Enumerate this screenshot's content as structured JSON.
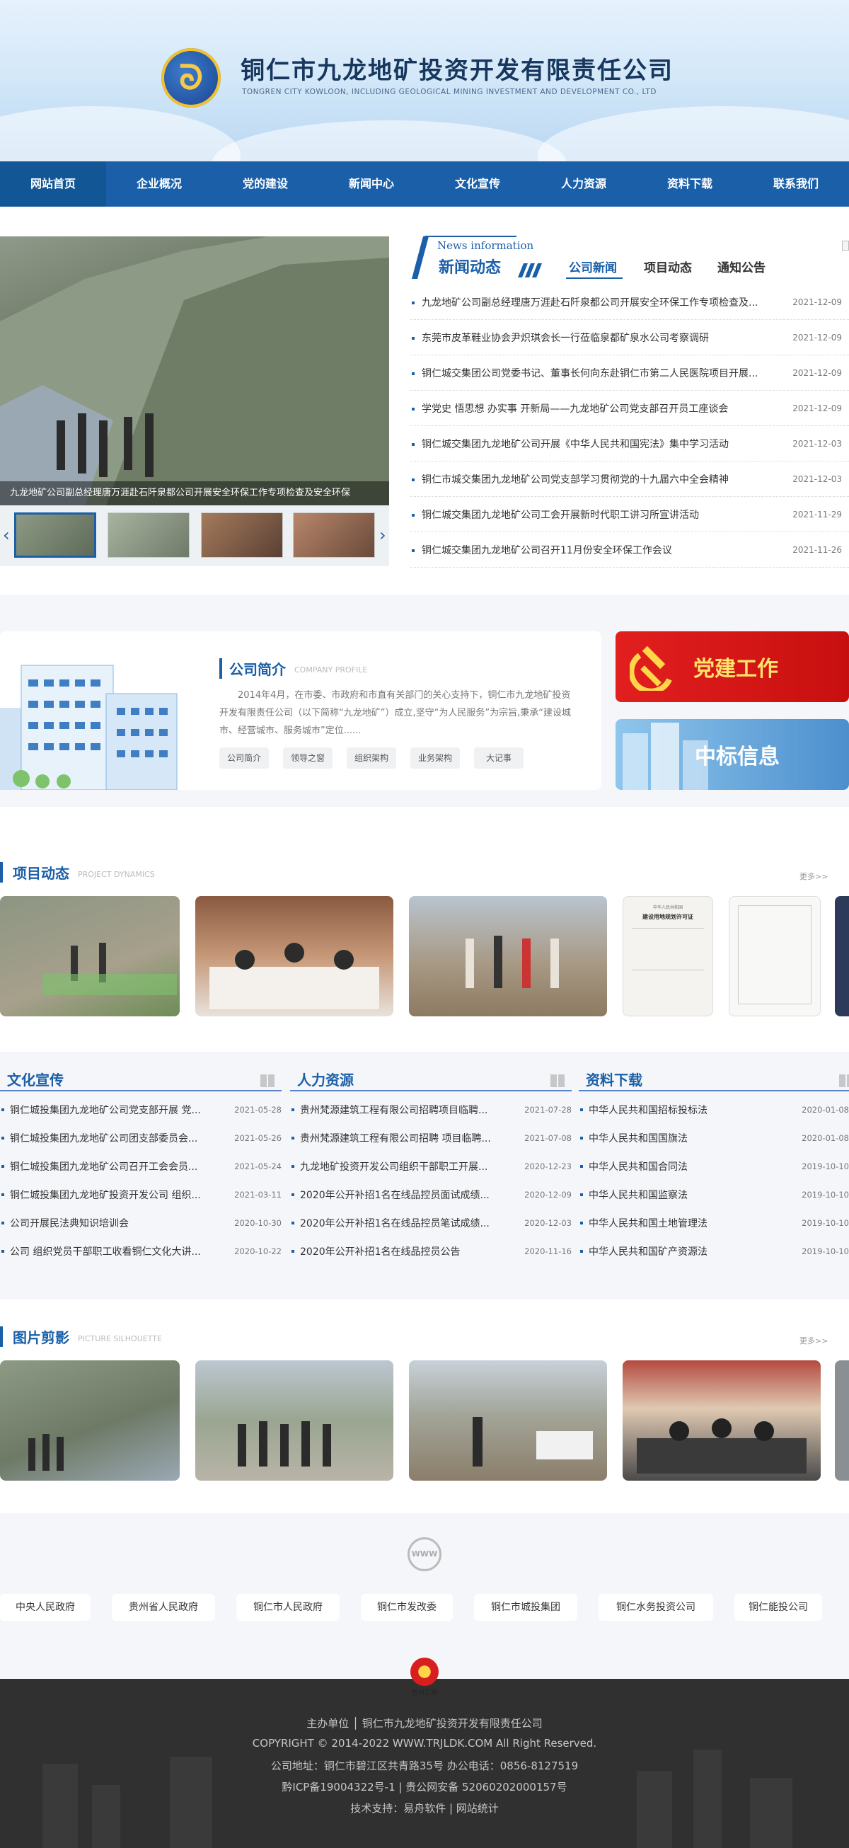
{
  "header": {
    "title": "铜仁市九龙地矿投资开发有限责任公司",
    "subtitle": "TONGREN CITY KOWLOON, INCLUDING GEOLOGICAL MINING INVESTMENT AND DEVELOPMENT CO., LTD"
  },
  "nav": [
    "网站首页",
    "企业概况",
    "党的建设",
    "新闻中心",
    "文化宣传",
    "人力资源",
    "资料下载",
    "联系我们"
  ],
  "slider": {
    "caption": "九龙地矿公司副总经理唐万涯赴石阡泉都公司开展安全环保工作专项检查及安全环保",
    "prev": "‹",
    "next": "›"
  },
  "news": {
    "en_title": "News information",
    "title": "新闻动态",
    "tabs": [
      "公司新闻",
      "项目动态",
      "通知公告"
    ],
    "items": [
      {
        "title": "九龙地矿公司副总经理唐万涯赴石阡泉都公司开展安全环保工作专项检查及...",
        "date": "2021-12-09"
      },
      {
        "title": "东莞市皮革鞋业协会尹炽琪会长一行莅临泉都矿泉水公司考察调研",
        "date": "2021-12-09"
      },
      {
        "title": "铜仁城交集团公司党委书记、董事长何向东赴铜仁市第二人民医院项目开展...",
        "date": "2021-12-09"
      },
      {
        "title": "学党史 悟思想 办实事 开新局——九龙地矿公司党支部召开员工座谈会",
        "date": "2021-12-09"
      },
      {
        "title": "铜仁城交集团九龙地矿公司开展《中华人民共和国宪法》集中学习活动",
        "date": "2021-12-03"
      },
      {
        "title": "铜仁市城交集团九龙地矿公司党支部学习贯彻党的十九届六中全会精神",
        "date": "2021-12-03"
      },
      {
        "title": "铜仁城交集团九龙地矿公司工会开展新时代职工讲习所宣讲活动",
        "date": "2021-11-29"
      },
      {
        "title": "铜仁城交集团九龙地矿公司召开11月份安全环保工作会议",
        "date": "2021-11-26"
      }
    ]
  },
  "intro": {
    "title": "公司简介",
    "en": "COMPANY PROFILE",
    "text": "2014年4月，在市委、市政府和市直有关部门的关心支持下，铜仁市九龙地矿投资开发有限责任公司（以下简称“九龙地矿”）成立,坚守“为人民服务”为宗旨,秉承“建设城市、经营城市、服务城市”定位......",
    "chips": [
      "公司简介",
      "领导之窗",
      "组织架构",
      "业务架构",
      "大记事"
    ]
  },
  "banners": {
    "party": "党建工作",
    "bid": "中标信息"
  },
  "projects": {
    "title": "项目动态",
    "en": "PROJECT DYNAMICS",
    "more": "更多>>"
  },
  "columns": [
    {
      "title": "文化宣传",
      "items": [
        {
          "t": "铜仁城投集团九龙地矿公司党支部开展 党...",
          "d": "2021-05-28"
        },
        {
          "t": "铜仁城投集团九龙地矿公司团支部委员会...",
          "d": "2021-05-26"
        },
        {
          "t": "铜仁城投集团九龙地矿公司召开工会会员...",
          "d": "2021-05-24"
        },
        {
          "t": "铜仁城投集团九龙地矿投资开发公司 组织...",
          "d": "2021-03-11"
        },
        {
          "t": "公司开展民法典知识培训会",
          "d": "2020-10-30"
        },
        {
          "t": "公司 组织党员干部职工收看铜仁文化大讲...",
          "d": "2020-10-22"
        }
      ]
    },
    {
      "title": "人力资源",
      "items": [
        {
          "t": "贵州梵源建筑工程有限公司招聘项目临聘...",
          "d": "2021-07-28"
        },
        {
          "t": "贵州梵源建筑工程有限公司招聘 项目临聘...",
          "d": "2021-07-08"
        },
        {
          "t": "九龙地矿投资开发公司组织干部职工开展...",
          "d": "2020-12-23"
        },
        {
          "t": "2020年公开补招1名在线品控员面试成绩...",
          "d": "2020-12-09"
        },
        {
          "t": "2020年公开补招1名在线品控员笔试成绩...",
          "d": "2020-12-03"
        },
        {
          "t": "2020年公开补招1名在线品控员公告",
          "d": "2020-11-16"
        }
      ]
    },
    {
      "title": "资料下载",
      "items": [
        {
          "t": "中华人民共和国招标投标法",
          "d": "2020-01-08"
        },
        {
          "t": "中华人民共和国国旗法",
          "d": "2020-01-08"
        },
        {
          "t": "中华人民共和国合同法",
          "d": "2019-10-10"
        },
        {
          "t": "中华人民共和国监察法",
          "d": "2019-10-10"
        },
        {
          "t": "中华人民共和国土地管理法",
          "d": "2019-10-10"
        },
        {
          "t": "中华人民共和国矿产资源法",
          "d": "2019-10-10"
        }
      ]
    }
  ],
  "gallery": {
    "title": "图片剪影",
    "en": "PICTURE SILHOUETTE",
    "more": "更多>>"
  },
  "permit": {
    "heading": "建设用地规划许可证",
    "org": "中华人民共和国"
  },
  "links": [
    "中央人民政府",
    "贵州省人民政府",
    "铜仁市人民政府",
    "铜仁市发改委",
    "铜仁市城投集团",
    "铜仁水务投资公司",
    "铜仁能投公司"
  ],
  "www": "WWW",
  "footer": {
    "badge": "贵州工商",
    "host": "主办单位 │ 铜仁市九龙地矿投资开发有限责任公司",
    "copyright": "COPYRIGHT © 2014-2022 WWW.TRJLDK.COM All Right Reserved.",
    "address": "公司地址：铜仁市碧江区共青路35号 办公电话：0856-8127519",
    "icp": "黔ICP备19004322号-1 | 贵公网安备 52060202000157号",
    "support": "技术支持：易舟软件 | 网站统计"
  }
}
